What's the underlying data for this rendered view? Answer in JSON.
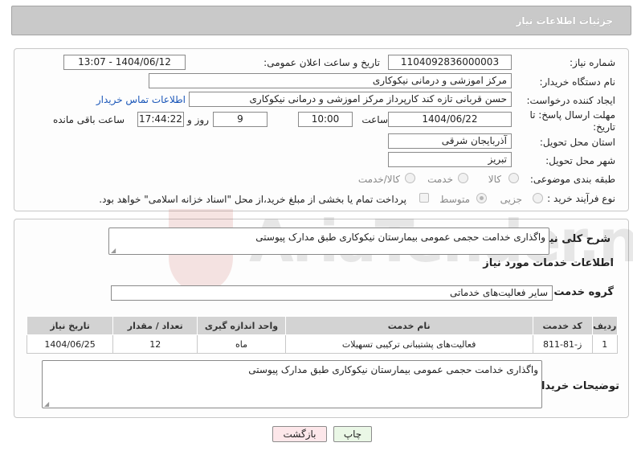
{
  "header": {
    "title": "جزئیات اطلاعات نیاز"
  },
  "fields": {
    "need_number_label": "شماره نیاز:",
    "need_number": "1104092836000003",
    "announce_label": "تاریخ و ساعت اعلان عمومی:",
    "announce_value": "1404/06/12 - 13:07",
    "buyer_org_label": "نام دستگاه خریدار:",
    "buyer_org": "مرکز اموزشی و درمانی نیکوکاری",
    "creator_label": "ایجاد کننده درخواست:",
    "creator": "حسن قربانی تازه کند کارپرداز مرکز اموزشی و درمانی نیکوکاری",
    "contact_link": "اطلاعات تماس خریدار",
    "deadline_label_line1": "مهلت ارسال پاسخ: تا",
    "deadline_label_line2": "تاریخ:",
    "deadline_date": "1404/06/22",
    "time_label": "ساعت",
    "deadline_time": "10:00",
    "days_value": "9",
    "days_label": "روز و",
    "remaining_time": "17:44:22",
    "remaining_label": "ساعت باقی مانده",
    "province_label": "استان محل تحویل:",
    "province": "آذربایجان شرقی",
    "city_label": "شهر محل تحویل:",
    "city": "تبریز",
    "category_label": "طبقه بندی موضوعی:",
    "category_options": [
      "کالا",
      "خدمت",
      "کالا/خدمت"
    ],
    "process_label": "نوع فرآیند خرید :",
    "process_options": [
      "جزیی",
      "متوسط"
    ],
    "payment_note": "پرداخت تمام یا بخشی از مبلغ خرید،از محل \"اسناد خزانه اسلامی\" خواهد بود."
  },
  "summary": {
    "label": "شرح کلی نیاز:",
    "value": "واگذاری خدامت حجمی عمومی بیمارستان نیکوکاری طبق مدارک پیوستی"
  },
  "services": {
    "section_title": "اطلاعات خدمات مورد نیاز",
    "group_label": "گروه خدمت:",
    "group_value": "سایر فعالیت‌های خدماتی",
    "columns": [
      "ردیف",
      "کد خدمت",
      "نام خدمت",
      "واحد اندازه گیری",
      "تعداد / مقدار",
      "تاریخ نیاز"
    ],
    "rows": [
      [
        "1",
        "ز-81-811",
        "فعالیت‌های پشتیبانی ترکیبی تسهیلات",
        "ماه",
        "12",
        "1404/06/25"
      ]
    ]
  },
  "buyer_notes": {
    "label": "توضیحات خریدار:",
    "value": "واگذاری خدامت حجمی عمومی بیمارستان نیکوکاری طبق مدارک پیوستی"
  },
  "buttons": {
    "print": "چاپ",
    "back": "بازگشت"
  },
  "watermark": {
    "text": "AriaTender.net"
  },
  "colors": {
    "header_bg": "#c9c9c9",
    "link": "#1a56b8",
    "back_button_bg": "#fde7ea",
    "print_button_bg": "#eaf7e6"
  }
}
